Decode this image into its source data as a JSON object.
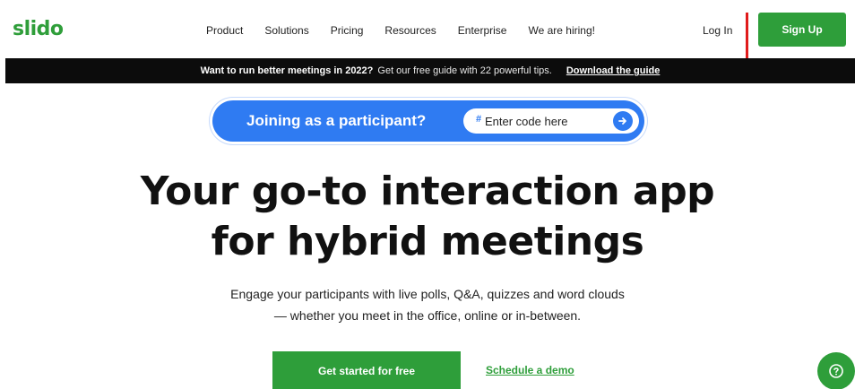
{
  "brand": {
    "logo": "slido",
    "accent": "#2e9e3a"
  },
  "nav": {
    "links": [
      "Product",
      "Solutions",
      "Pricing",
      "Resources",
      "Enterprise",
      "We are hiring!"
    ],
    "login": "Log In",
    "signup": "Sign Up"
  },
  "announcement": {
    "bold": "Want to run better meetings in 2022?",
    "text": "Get our free guide with 22 powerful tips.",
    "link": "Download the guide"
  },
  "participant": {
    "label": "Joining as a participant?",
    "placeholder": "Enter code here",
    "hash": "#"
  },
  "hero": {
    "title_line1": "Your go-to interaction app",
    "title_line2": "for hybrid meetings",
    "sub_line1": "Engage your participants with live polls, Q&A, quizzes and word clouds",
    "sub_line2": "— whether you meet in the office, online or in-between."
  },
  "cta": {
    "primary": "Get started for free",
    "secondary": "Schedule a demo"
  },
  "icons": {
    "go": "arrow-right-icon",
    "help": "help-icon"
  }
}
